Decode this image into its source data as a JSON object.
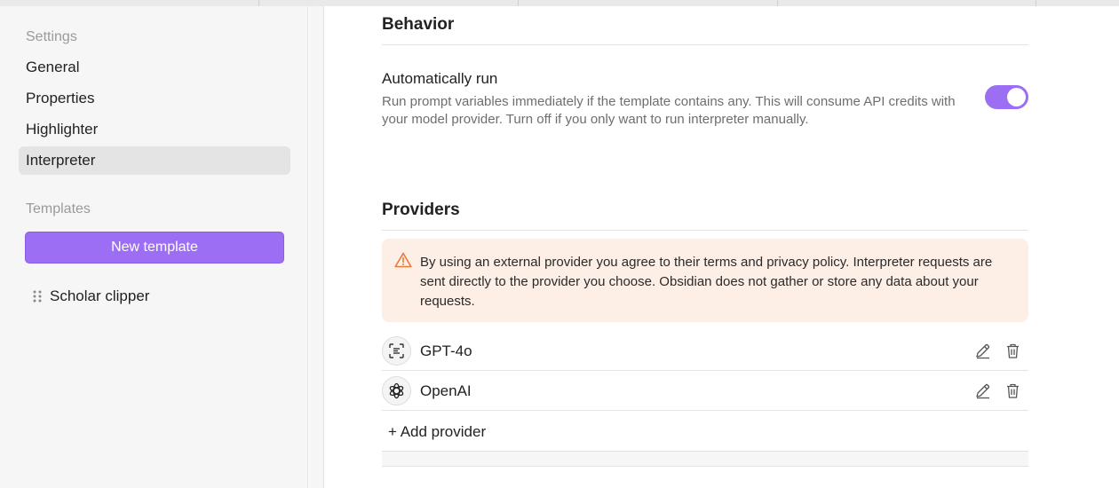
{
  "sidebar": {
    "settings_label": "Settings",
    "items": [
      {
        "label": "General"
      },
      {
        "label": "Properties"
      },
      {
        "label": "Highlighter"
      },
      {
        "label": "Interpreter",
        "active": true
      }
    ],
    "templates_label": "Templates",
    "new_template_label": "New template",
    "templates": [
      {
        "label": "Scholar clipper"
      }
    ]
  },
  "main": {
    "behavior_heading": "Behavior",
    "auto_run": {
      "name": "Automatically run",
      "description": "Run prompt variables immediately if the template contains any. This will consume API credits with your model provider. Turn off if you only want to run interpreter manually.",
      "enabled": true
    },
    "providers_heading": "Providers",
    "notice": "By using an external provider you agree to their terms and privacy policy. Interpreter requests are sent directly to the provider you choose. Obsidian does not gather or store any data about your requests.",
    "providers": [
      {
        "name": "GPT-4o",
        "icon": "scan-text-icon"
      },
      {
        "name": "OpenAI",
        "icon": "openai-logo-icon"
      }
    ],
    "add_provider_label": "+ Add provider"
  },
  "colors": {
    "accent": "#9b6ef3",
    "notice_bg": "#fdeee6",
    "warning": "#e8793b"
  }
}
